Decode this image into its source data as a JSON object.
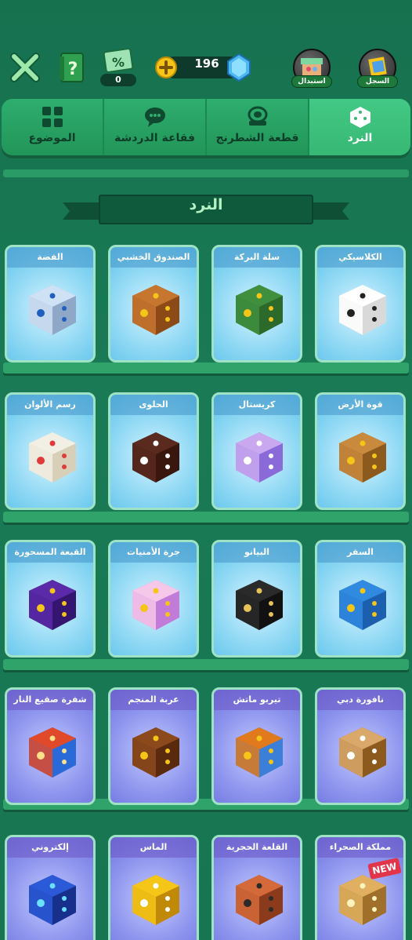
{
  "topbar": {
    "coupon_count": "0",
    "currency_amount": "196",
    "shop_label": "استبدال",
    "history_label": "السجل"
  },
  "tabs": [
    {
      "label": "الموضوع",
      "icon": "grid-icon"
    },
    {
      "label": "فقاعة الدردشة",
      "icon": "chat-bubble-icon"
    },
    {
      "label": "قطعة الشطرنج",
      "icon": "chess-piece-icon"
    },
    {
      "label": "النرد",
      "icon": "dice-icon",
      "active": true
    }
  ],
  "section": {
    "title": "النرد"
  },
  "dice": [
    {
      "name": "الكلاسيكي",
      "style": "white"
    },
    {
      "name": "سلة البركة",
      "style": "basket"
    },
    {
      "name": "الصندوق الخشبي",
      "style": "wood"
    },
    {
      "name": "الفضة",
      "style": "silver"
    },
    {
      "name": "قوة الأرض",
      "style": "earth"
    },
    {
      "name": "كريستال",
      "style": "crystal"
    },
    {
      "name": "الحلوى",
      "style": "candy"
    },
    {
      "name": "رسم الألوان",
      "style": "paint"
    },
    {
      "name": "السفر",
      "style": "travel"
    },
    {
      "name": "البيانو",
      "style": "piano"
    },
    {
      "name": "جرة الأمنيات",
      "style": "jar"
    },
    {
      "name": "القبعة المسحورة",
      "style": "magic"
    },
    {
      "name": "نافورة دبي",
      "style": "fountain"
    },
    {
      "name": "تيربو ماتش",
      "style": "turbo"
    },
    {
      "name": "عربة المنجم",
      "style": "mine"
    },
    {
      "name": "شفرة صقيع النار",
      "style": "frostfire"
    },
    {
      "name": "مملكة الصحراء",
      "style": "desert",
      "badge": "NEW"
    },
    {
      "name": "القلعة الحجرية",
      "style": "castle"
    },
    {
      "name": "الماس",
      "style": "diamond"
    },
    {
      "name": "إلكتروني",
      "style": "electronic"
    }
  ],
  "colors": {
    "accent": "#2eae6f",
    "bg": "#177651",
    "gold": "#f5c518"
  }
}
